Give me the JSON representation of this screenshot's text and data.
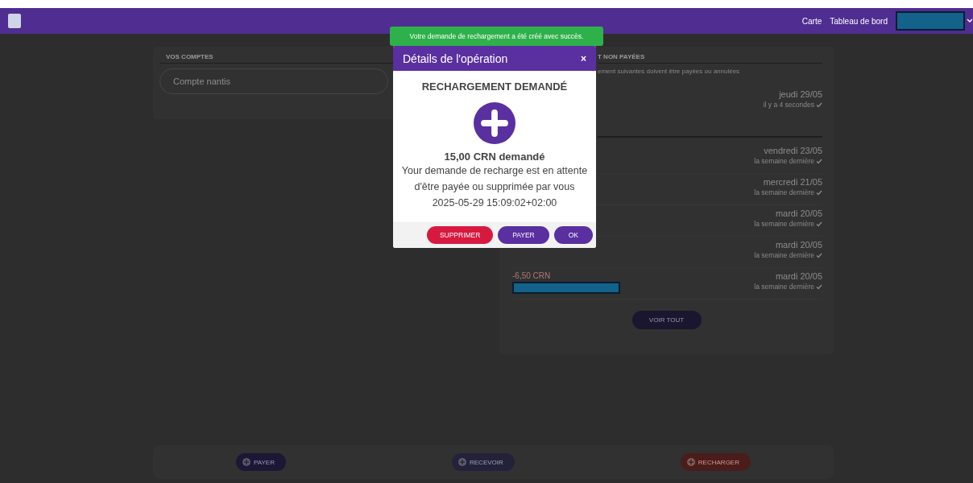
{
  "navbar": {
    "links": [
      "Carte",
      "Tableau de bord"
    ]
  },
  "accounts": {
    "heading": "VOS COMPTES",
    "account": "Compte nantis"
  },
  "payments": {
    "heading": "T NON PAYÉES",
    "note": "ement suivantes doivent être payées ou annulées",
    "pending": [
      {
        "date": "jeudi 29/05",
        "time": "il y a 4 secondes"
      }
    ],
    "recent": [
      {
        "date": "vendredi 23/05",
        "time": "la semaine dernière"
      },
      {
        "date": "mercredi 21/05",
        "time": "la semaine dernière"
      },
      {
        "date": "mardi 20/05",
        "time": "la semaine dernière"
      },
      {
        "date": "mardi 20/05",
        "time": "la semaine dernière"
      },
      {
        "amount": "-6,50 CRN",
        "date": "mardi 20/05",
        "time": "la semaine dernière"
      }
    ],
    "see_all": "VOIR TOUT"
  },
  "actions": [
    {
      "label": "PAYER",
      "kind": "pay"
    },
    {
      "label": "RECEVOIR",
      "kind": "receive"
    },
    {
      "label": "RECHARGER",
      "kind": "recharge"
    }
  ],
  "toast": "Votre demande de rechargement a été créé avec succès.",
  "modal": {
    "title": "Détails de l'opération",
    "close": "×",
    "heading": "RECHARGEMENT DEMANDÉ",
    "amount": "15,00 CRN demandé",
    "message": "Your demande de recharge est en attente d'être payée ou supprimée par vous",
    "timestamp": "2025-05-29 15:09:02+02:00",
    "buttons": [
      {
        "label": "SUPPRIMER",
        "kind": "danger"
      },
      {
        "label": "PAYER",
        "kind": "primary"
      },
      {
        "label": "OK",
        "kind": "primary"
      }
    ]
  }
}
